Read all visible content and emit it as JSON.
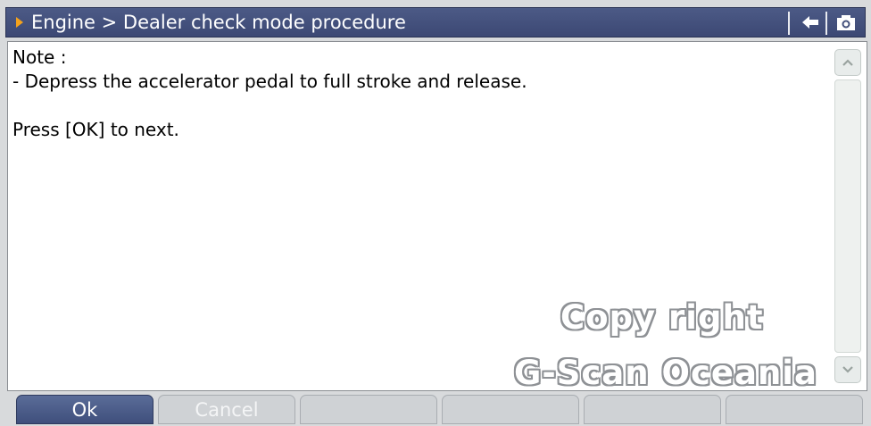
{
  "header": {
    "title": "Engine > Dealer check mode procedure",
    "back_icon": "back-arrow-icon",
    "camera_icon": "camera-icon"
  },
  "content": {
    "lines": [
      "Note :",
      "- Depress the accelerator pedal to full stroke and release.",
      "",
      "Press [OK] to next."
    ]
  },
  "watermark": {
    "line1": "Copy right",
    "line2": "G-Scan Oceania"
  },
  "buttons": [
    {
      "label": "Ok"
    },
    {
      "label": "Cancel"
    },
    {
      "label": ""
    },
    {
      "label": ""
    },
    {
      "label": ""
    },
    {
      "label": ""
    }
  ],
  "colors": {
    "title_bar": "#44517c",
    "accent_arrow": "#f4a21c",
    "primary_button": "#4a5b88"
  }
}
